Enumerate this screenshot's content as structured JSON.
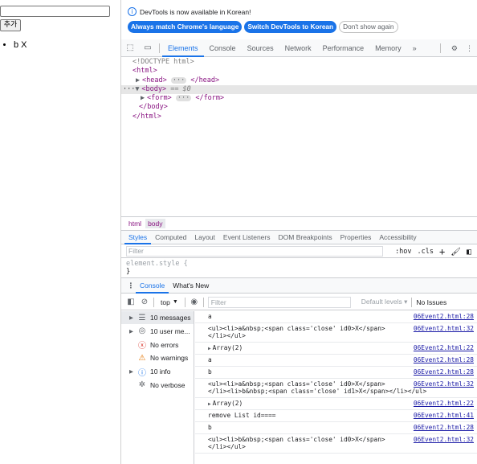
{
  "page": {
    "add_button": "추가",
    "list_items": [
      {
        "text": "b",
        "close": "X"
      }
    ]
  },
  "devtools": {
    "notice": {
      "text": "DevTools is now available in Korean!",
      "buttons": [
        "Always match Chrome's language",
        "Switch DevTools to Korean",
        "Don't show again"
      ]
    },
    "tabs": [
      "Elements",
      "Console",
      "Sources",
      "Network",
      "Performance",
      "Memory"
    ],
    "active_tab": "Elements",
    "more_tabs": "»",
    "dom": {
      "doctype": "<!DOCTYPE html>",
      "html_open": "<html>",
      "head": "<head>",
      "head_close": "</head>",
      "body": "<body>",
      "selection_marker": "== $0",
      "form": "<form>",
      "form_close": "</form>",
      "body_close": "</body>",
      "html_close": "</html>",
      "ellipsis": "···",
      "dots": "···"
    },
    "breadcrumbs": [
      "html",
      "body"
    ],
    "sub_tabs": [
      "Styles",
      "Computed",
      "Layout",
      "Event Listeners",
      "DOM Breakpoints",
      "Properties",
      "Accessibility"
    ],
    "styles_filter_placeholder": "Filter",
    "styles_tools": {
      "hov": ":hov",
      "cls": ".cls"
    },
    "element_style": {
      "selector": "element.style {",
      "close": "}"
    },
    "drawer_tabs": [
      "Console",
      "What's New"
    ],
    "console_bar": {
      "context": "top",
      "filter_placeholder": "Filter",
      "levels": "Default levels ▾",
      "issues": "No Issues"
    },
    "sidebar": [
      {
        "label": "10 messages",
        "icon": "list-icon",
        "caret": "▶",
        "selected": true
      },
      {
        "label": "10 user me...",
        "icon": "user-icon",
        "caret": "▶",
        "selected": false
      },
      {
        "label": "No errors",
        "icon": "error-icon",
        "caret": "",
        "selected": false
      },
      {
        "label": "No warnings",
        "icon": "warning-icon",
        "caret": "",
        "selected": false
      },
      {
        "label": "10 info",
        "icon": "info-icon",
        "caret": "▶",
        "selected": false
      },
      {
        "label": "No verbose",
        "icon": "bug-icon",
        "caret": "",
        "selected": false
      }
    ],
    "messages": [
      {
        "text": "a",
        "src": "06Event2.html:28",
        "expandable": false
      },
      {
        "text": "<ul><li>a&nbsp;<span class='close' id0>X</span>\n</li></ul>",
        "src": "06Event2.html:32",
        "expandable": false
      },
      {
        "text": "Array(2)",
        "src": "06Event2.html:22",
        "expandable": true
      },
      {
        "text": "a",
        "src": "06Event2.html:28",
        "expandable": false
      },
      {
        "text": "b",
        "src": "06Event2.html:28",
        "expandable": false
      },
      {
        "text": "<ul><li>a&nbsp;<span class='close' id0>X</span>\n</li><li>b&nbsp;<span class='close' id1>X</span></li></ul>",
        "src": "06Event2.html:32",
        "expandable": false
      },
      {
        "text": "Array(2)",
        "src": "06Event2.html:22",
        "expandable": true
      },
      {
        "text": "remove List id====",
        "src": "06Event2.html:41",
        "expandable": false
      },
      {
        "text": "b",
        "src": "06Event2.html:28",
        "expandable": false
      },
      {
        "text": "<ul><li>b&nbsp;<span class='close' id0>X</span>\n</li></ul>",
        "src": "06Event2.html:32",
        "expandable": false
      }
    ]
  }
}
